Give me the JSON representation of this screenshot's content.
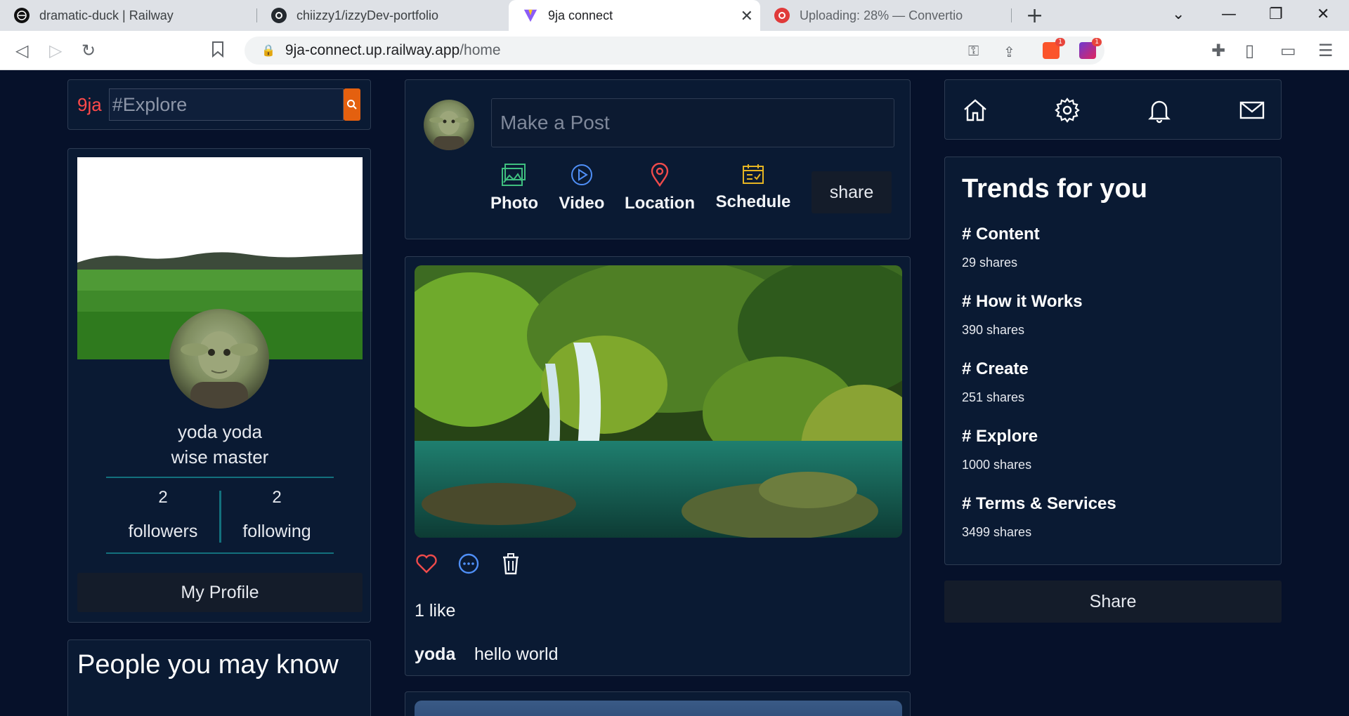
{
  "browser": {
    "tabs": [
      {
        "title": "dramatic-duck | Railway",
        "active": false
      },
      {
        "title": "chiizzy1/izzyDev-portfolio",
        "active": false
      },
      {
        "title": "9ja connect",
        "active": true
      },
      {
        "title": "Uploading: 28% — Convertio",
        "active": false
      }
    ],
    "url_host": "9ja-connect.up.railway.app",
    "url_path": "/home",
    "extension_badges": [
      "1",
      "1"
    ]
  },
  "search": {
    "logo": "9ja",
    "placeholder": "#Explore"
  },
  "profile": {
    "name": "yoda yoda",
    "bio": "wise master",
    "followers_count": "2",
    "followers_label": "followers",
    "following_count": "2",
    "following_label": "following",
    "profile_button": "My Profile"
  },
  "people": {
    "title": "People you may know"
  },
  "composer": {
    "placeholder": "Make a Post",
    "options": {
      "photo": "Photo",
      "video": "Video",
      "location": "Location",
      "schedule": "Schedule"
    },
    "share_label": "share"
  },
  "post": {
    "likes": "1 like",
    "user": "yoda",
    "text": "hello world"
  },
  "trends": {
    "title": "Trends for you",
    "items": [
      {
        "tag": "# Content",
        "shares": "29 shares"
      },
      {
        "tag": "# How it Works",
        "shares": "390 shares"
      },
      {
        "tag": "# Create",
        "shares": "251 shares"
      },
      {
        "tag": "# Explore",
        "shares": "1000 shares"
      },
      {
        "tag": "# Terms & Services",
        "shares": "3499 shares"
      }
    ]
  },
  "share_button": "Share",
  "colors": {
    "background": "#06112a",
    "card": "#0a1a33",
    "accent_orange": "#e4600f",
    "accent_red": "#ff4a4a",
    "divider_teal": "#13707d"
  }
}
